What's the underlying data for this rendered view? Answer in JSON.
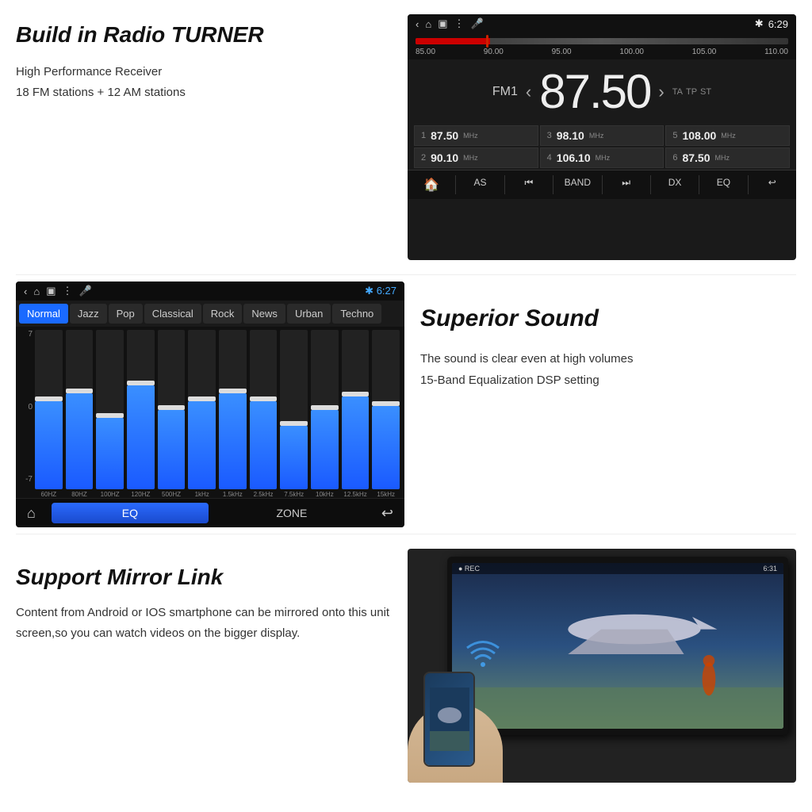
{
  "radio_section": {
    "title": "Build in Radio TURNER",
    "desc_line1": "High Performance Receiver",
    "desc_line2": "18 FM stations + 12 AM stations",
    "screen": {
      "time": "6:29",
      "band": "FM1",
      "frequency": "87.50",
      "ta_labels": [
        "TA",
        "TP",
        "ST"
      ],
      "slider_labels": [
        "85.00",
        "90.00",
        "95.00",
        "100.00",
        "105.00",
        "110.00"
      ],
      "presets": [
        {
          "num": "1",
          "freq": "87.50",
          "unit": "MHz"
        },
        {
          "num": "3",
          "freq": "98.10",
          "unit": "MHz"
        },
        {
          "num": "5",
          "freq": "108.00",
          "unit": "MHz"
        },
        {
          "num": "2",
          "freq": "90.10",
          "unit": "MHz"
        },
        {
          "num": "4",
          "freq": "106.10",
          "unit": "MHz"
        },
        {
          "num": "6",
          "freq": "87.50",
          "unit": "MHz"
        }
      ],
      "bottom_buttons": [
        "🏠",
        "AS",
        "⏮",
        "BAND",
        "⏭",
        "DX",
        "EQ",
        "↩"
      ]
    }
  },
  "eq_section": {
    "screen": {
      "time": "6:27",
      "modes": [
        "Normal",
        "Jazz",
        "Pop",
        "Classical",
        "Rock",
        "News",
        "Urban",
        "Techno"
      ],
      "active_mode": "Normal",
      "y_labels": [
        "7",
        "0",
        "-7"
      ],
      "bars": [
        {
          "label": "60HZ",
          "fill_pct": 55,
          "handle_pct": 55
        },
        {
          "label": "80HZ",
          "fill_pct": 60,
          "handle_pct": 60
        },
        {
          "label": "100HZ",
          "fill_pct": 45,
          "handle_pct": 45
        },
        {
          "label": "120HZ",
          "fill_pct": 65,
          "handle_pct": 65
        },
        {
          "label": "500HZ",
          "fill_pct": 50,
          "handle_pct": 50
        },
        {
          "label": "1kHz",
          "fill_pct": 55,
          "handle_pct": 55
        },
        {
          "label": "1.5kHz",
          "fill_pct": 60,
          "handle_pct": 60
        },
        {
          "label": "2.5kHz",
          "fill_pct": 55,
          "handle_pct": 55
        },
        {
          "label": "7.5kHz",
          "fill_pct": 40,
          "handle_pct": 40
        },
        {
          "label": "10kHz",
          "fill_pct": 50,
          "handle_pct": 50
        },
        {
          "label": "12.5kHz",
          "fill_pct": 58,
          "handle_pct": 58
        },
        {
          "label": "15kHz",
          "fill_pct": 52,
          "handle_pct": 52
        }
      ],
      "bottom_eq": "EQ",
      "bottom_zone": "ZONE"
    },
    "title": "Superior Sound",
    "desc_line1": "The sound is clear even at high volumes",
    "desc_line2": "15-Band Equalization DSP setting"
  },
  "mirror_section": {
    "title": "Support Mirror Link",
    "desc": "Content from Android or IOS smartphone can be mirrored onto this unit screen,so you can watch videos on the  bigger display.",
    "screen": {
      "time": "6:31"
    }
  }
}
